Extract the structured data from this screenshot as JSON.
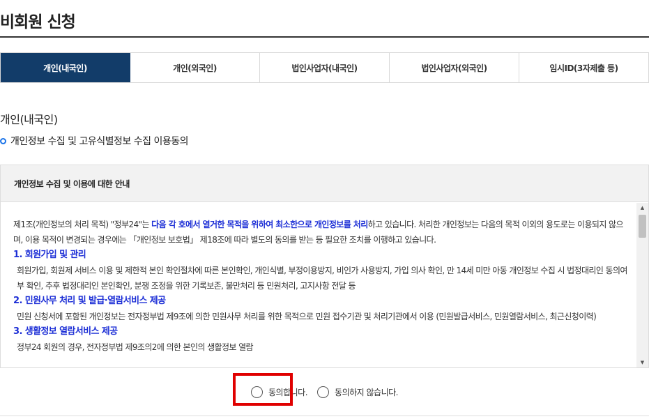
{
  "page": {
    "title": "비회원 신청"
  },
  "tabs": [
    {
      "label": "개인(내국인)",
      "active": true
    },
    {
      "label": "개인(외국인)",
      "active": false
    },
    {
      "label": "법인사업자(내국인)",
      "active": false
    },
    {
      "label": "법인사업자(외국인)",
      "active": false
    },
    {
      "label": "임시ID(3자제출 등)",
      "active": false
    }
  ],
  "section": {
    "title": "개인(내국인)",
    "consent_heading": "개인정보 수집 및 고유식별정보 수집 이용동의"
  },
  "guide": {
    "header": "개인정보 수집 및 이용에 대한 안내",
    "intro_pre": "제1조(개인정보의 처리 목적) \"정부24\"는 ",
    "intro_hl": "다음 각 호에서 열거한 목적을 위하여 최소한으로 개인정보를 처리",
    "intro_post": "하고 있습니다. 처리한 개인정보는 다음의 목적 이외의 용도로는 이용되지 않으며, 이용 목적이 변경되는 경우에는 「개인정보 보호법」 제18조에 따라 별도의 동의를 받는 등 필요한 조치를 이행하고 있습니다.",
    "items": [
      {
        "heading": "1. 회원가입 및 관리",
        "text": "회원가입, 회원제 서비스 이용 및 제한적 본인 확인절차에 따른 본인확인, 개인식별, 부정이용방지, 비인가 사용방지, 가입 의사 확인, 만 14세 미만 아동 개인정보 수집 시 법정대리인 동의여부 확인, 추후 법정대리인 본인확인, 분쟁 조정을 위한 기록보존, 불만처리 등 민원처리, 고지사항 전달 등"
      },
      {
        "heading": "2. 민원사무 처리 및 발급·열람서비스 제공",
        "text": "민원 신청서에 포함된 개인정보는 전자정부법 제9조에 의한 민원사무 처리를 위한 목적으로 민원 접수기관 및 처리기관에서 이용 (민원발급서비스, 민원열람서비스, 최근신청이력)"
      },
      {
        "heading": "3. 생활정보 열람서비스 제공",
        "text": "정부24 회원의 경우, 전자정부법 제9조의2에 의한 본인의 생활정보 열람"
      }
    ]
  },
  "agree": {
    "yes_label": "동의합니다.",
    "no_label": "동의하지 않습니다."
  },
  "colors": {
    "accent": "#123c69",
    "highlight": "#1d2fd6",
    "marker": "#e00000"
  }
}
